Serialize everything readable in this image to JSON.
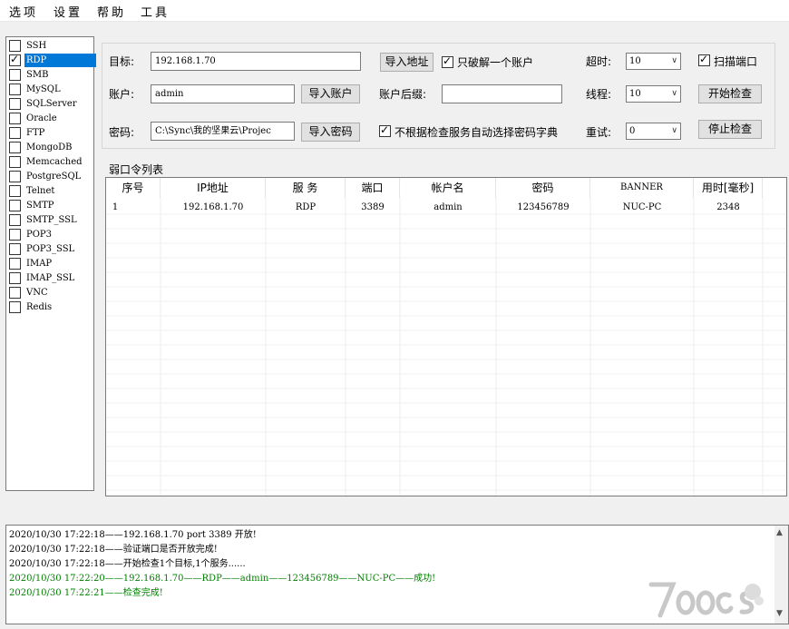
{
  "menu": [
    "选项",
    "设置",
    "帮助",
    "工具"
  ],
  "services": [
    {
      "label": "SSH",
      "checked": false,
      "selected": false
    },
    {
      "label": "RDP",
      "checked": true,
      "selected": true
    },
    {
      "label": "SMB",
      "checked": false,
      "selected": false
    },
    {
      "label": "MySQL",
      "checked": false,
      "selected": false
    },
    {
      "label": "SQLServer",
      "checked": false,
      "selected": false
    },
    {
      "label": "Oracle",
      "checked": false,
      "selected": false
    },
    {
      "label": "FTP",
      "checked": false,
      "selected": false
    },
    {
      "label": "MongoDB",
      "checked": false,
      "selected": false
    },
    {
      "label": "Memcached",
      "checked": false,
      "selected": false
    },
    {
      "label": "PostgreSQL",
      "checked": false,
      "selected": false
    },
    {
      "label": "Telnet",
      "checked": false,
      "selected": false
    },
    {
      "label": "SMTP",
      "checked": false,
      "selected": false
    },
    {
      "label": "SMTP_SSL",
      "checked": false,
      "selected": false
    },
    {
      "label": "POP3",
      "checked": false,
      "selected": false
    },
    {
      "label": "POP3_SSL",
      "checked": false,
      "selected": false
    },
    {
      "label": "IMAP",
      "checked": false,
      "selected": false
    },
    {
      "label": "IMAP_SSL",
      "checked": false,
      "selected": false
    },
    {
      "label": "VNC",
      "checked": false,
      "selected": false
    },
    {
      "label": "Redis",
      "checked": false,
      "selected": false
    }
  ],
  "config": {
    "target_label": "目标:",
    "target_value": "192.168.1.70",
    "import_target_btn": "导入地址",
    "single_account_label": "只破解一个账户",
    "single_account_checked": true,
    "timeout_label": "超时:",
    "timeout_value": "10",
    "scan_port_label": "扫描端口",
    "scan_port_checked": true,
    "account_label": "账户:",
    "account_value": "admin",
    "import_account_btn": "导入账户",
    "suffix_label": "账户后缀:",
    "suffix_value": "",
    "threads_label": "线程:",
    "threads_value": "10",
    "start_btn": "开始检查",
    "password_label": "密码:",
    "password_value": "C:\\Sync\\我的坚果云\\Projec",
    "import_password_btn": "导入密码",
    "auto_dict_label": "不根据检查服务自动选择密码字典",
    "auto_dict_checked": true,
    "retry_label": "重试:",
    "retry_value": "0",
    "stop_btn": "停止检查"
  },
  "results_title": "弱口令列表",
  "table": {
    "columns": [
      "序号",
      "IP地址",
      "服 务",
      "端口",
      "帐户名",
      "密码",
      "BANNER",
      "用时[毫秒]"
    ],
    "rows": [
      [
        "1",
        "192.168.1.70",
        "RDP",
        "3389",
        "admin",
        "123456789",
        "NUC-PC",
        "2348"
      ]
    ]
  },
  "log": [
    {
      "text": "2020/10/30 17:22:18——192.168.1.70 port 3389 开放!",
      "status": "normal"
    },
    {
      "text": "2020/10/30 17:22:18——验证端口是否开放完成!",
      "status": "normal"
    },
    {
      "text": "2020/10/30 17:22:18——开始检查1个目标,1个服务......",
      "status": "normal"
    },
    {
      "text": "2020/10/30 17:22:20——192.168.1.70——RDP——admin——123456789——NUC-PC——成功!",
      "status": "success"
    },
    {
      "text": "2020/10/30 17:22:21——检查完成!",
      "status": "success"
    }
  ],
  "colors": {
    "selection": "#0078d7",
    "success": "#008000"
  },
  "icons": {
    "check": "check-icon",
    "dropdown": "chevron-down-icon",
    "scroll_up": "scroll-up-icon",
    "scroll_down": "scroll-down-icon"
  }
}
